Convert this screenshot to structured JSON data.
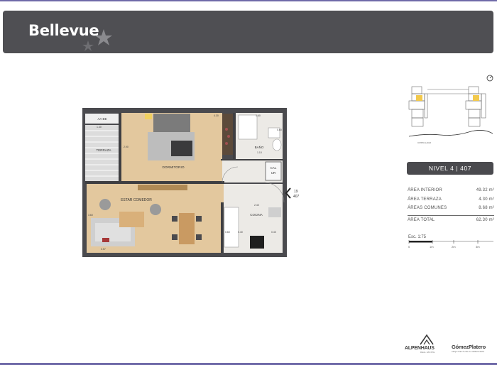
{
  "header": {
    "brand": "Bellevue"
  },
  "plan": {
    "rooms": {
      "bedroom": "DORMITORIO",
      "terrace": "TERRAZA",
      "bathroom": "BAÑO",
      "living": "ESTAR COMEDOR",
      "kitchen": "COCINA",
      "heater_line1": "CAL",
      "heater_line2": "UR",
      "closet": "AA EE"
    },
    "dimensions": {
      "bed_width": "4.30",
      "bath_width": "1.60",
      "bed_depth": "2.90",
      "kitchen_width": "2.40",
      "living_width": "3.57",
      "bath_depth": "1.10",
      "terrace_width": "1.40",
      "living_depth": "3.60",
      "bath_side": "0.60",
      "kitchen_depth": "0.60",
      "kitchen_side": "0.40",
      "heater_dim": "0.40"
    },
    "entry_marker": {
      "line1": "19",
      "line2": "407"
    }
  },
  "keyplan": {
    "street_label": "COSTA LAGO"
  },
  "unit": {
    "label": "NIVEL 4 | 407"
  },
  "areas": [
    {
      "name": "ÁREA INTERIOR",
      "value": "49.32 m²"
    },
    {
      "name": "ÁREA TERRAZA",
      "value": "4.30 m²"
    },
    {
      "name": "ÁREAS COMUNES",
      "value": "8.68 m²"
    }
  ],
  "area_total": {
    "name": "ÁREA TOTAL",
    "value": "62.30 m²"
  },
  "scale": {
    "label": "Esc. 1:75",
    "ticks": [
      "0",
      "1m",
      "2m",
      "3m"
    ]
  },
  "logos": {
    "alpen": "ALPENHAUS",
    "alpen_sub": "REAL ESTATE",
    "gp": "GómezPlatero",
    "gp_sub": "ARQUITECTURA & URBANISMO"
  },
  "colors": {
    "banner": "#4f4f53",
    "wood_floor": "#e3c89e",
    "tile_floor": "#eceae6",
    "wall": "#3f3f42",
    "accent_line": "#6f6aa8",
    "key_highlight": "#f2c94c"
  }
}
